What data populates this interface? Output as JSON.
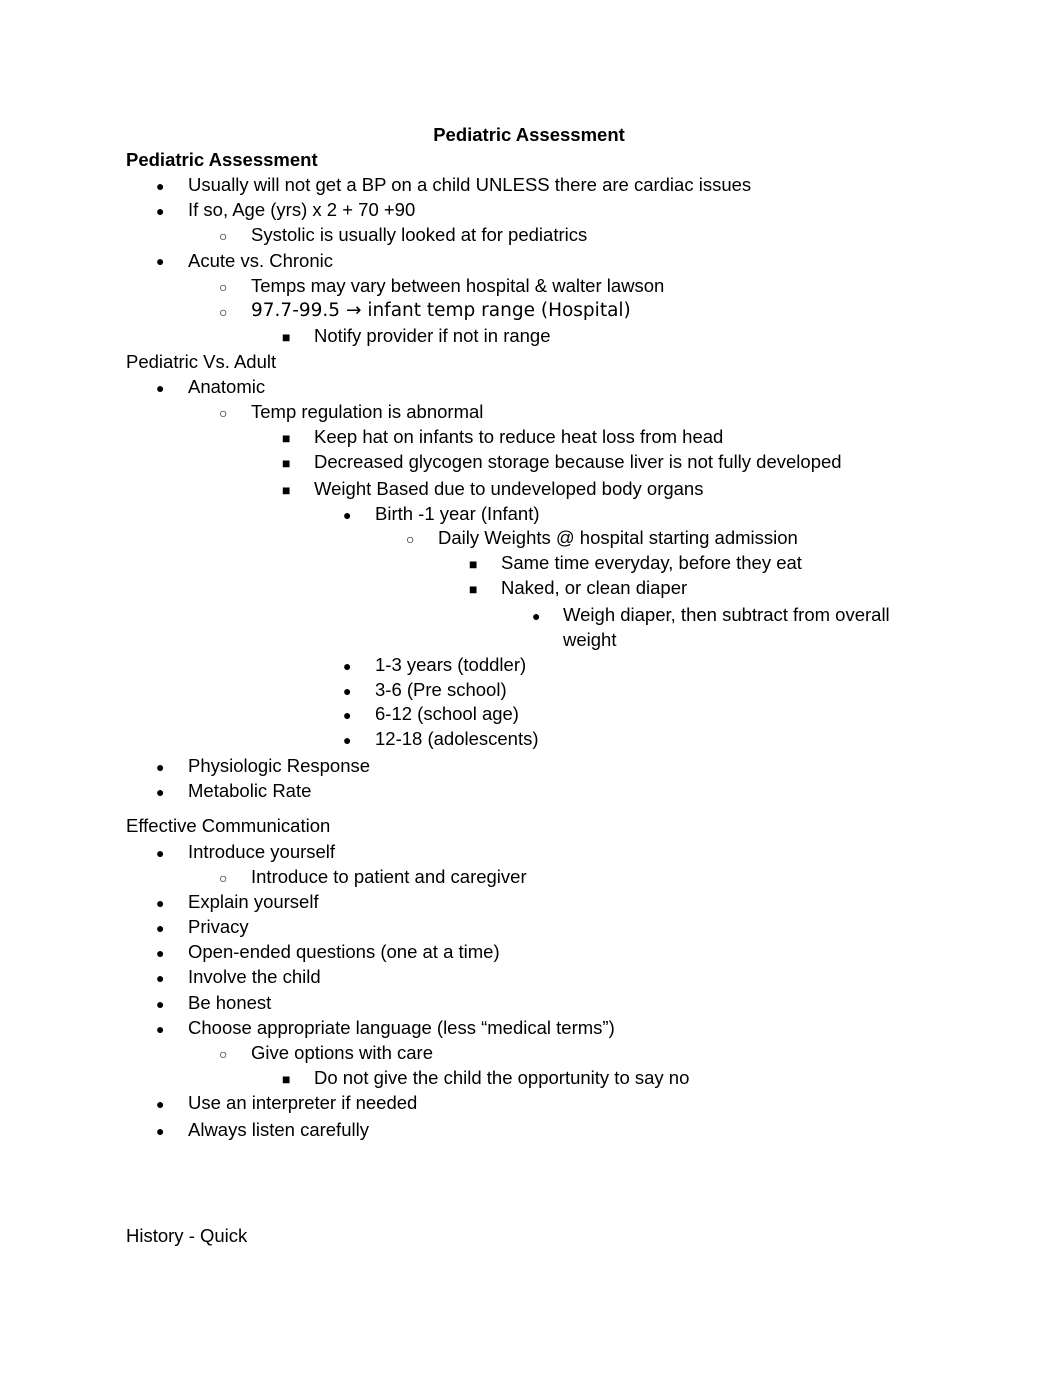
{
  "document": {
    "title": "Pediatric Assessment",
    "sections": [
      {
        "heading": "Pediatric Assessment",
        "items": [
          {
            "text": "Usually will not get a BP on a child UNLESS there are cardiac issues",
            "level": 1
          },
          {
            "text": "If so, Age (yrs) x 2 + 70 +90",
            "level": 1
          },
          {
            "text": "Systolic is usually looked at for pediatrics",
            "level": 2
          },
          {
            "text": "Acute vs. Chronic",
            "level": 1
          },
          {
            "text": "Temps may vary between hospital & walter lawson",
            "level": 2
          },
          {
            "text": "97.7-99.5 → infant temp range (Hospital)",
            "level": 2
          },
          {
            "text": "Notify provider if not in range",
            "level": 3
          }
        ]
      },
      {
        "heading": "Pediatric Vs. Adult",
        "items": [
          {
            "text": "Anatomic",
            "level": 1
          },
          {
            "text": "Temp regulation is abnormal",
            "level": 2
          },
          {
            "text": "Keep hat on infants to reduce heat loss from head",
            "level": 3
          },
          {
            "text": "Decreased glycogen storage because liver is not fully developed",
            "level": 3
          },
          {
            "text": "Weight Based due to undeveloped body organs",
            "level": 3
          },
          {
            "text": "Birth -1 year (Infant)",
            "level": 4
          },
          {
            "text": "Daily Weights @ hospital starting admission",
            "level": 5
          },
          {
            "text": "Same time everyday, before they eat",
            "level": 6
          },
          {
            "text": "Naked, or clean diaper",
            "level": 6
          },
          {
            "text": "Weigh diaper, then subtract from overall",
            "level": 7
          },
          {
            "text": "weight",
            "level": 7
          },
          {
            "text": "1-3 years (toddler)",
            "level": 4
          },
          {
            "text": "3-6 (Pre school)",
            "level": 4
          },
          {
            "text": "6-12 (school age)",
            "level": 4
          },
          {
            "text": "12-18 (adolescents)",
            "level": 4
          },
          {
            "text": "Physiologic Response",
            "level": 1
          },
          {
            "text": "Metabolic Rate",
            "level": 1
          }
        ]
      },
      {
        "heading": "Effective Communication",
        "items": [
          {
            "text": "Introduce yourself",
            "level": 1
          },
          {
            "text": "Introduce to patient and caregiver",
            "level": 2
          },
          {
            "text": "Explain yourself",
            "level": 1
          },
          {
            "text": "Privacy",
            "level": 1
          },
          {
            "text": "Open-ended questions (one at a time)",
            "level": 1
          },
          {
            "text": "Involve the child",
            "level": 1
          },
          {
            "text": "Be honest",
            "level": 1
          },
          {
            "text": "Choose appropriate language (less “medical  terms”)",
            "level": 1
          },
          {
            "text": "Give options with care",
            "level": 2
          },
          {
            "text": "Do not give the child the opportunity to say no",
            "level": 3
          },
          {
            "text": "Use an interpreter if needed",
            "level": 1
          },
          {
            "text": "Always listen carefully",
            "level": 1
          }
        ]
      },
      {
        "heading": "History - Quick",
        "items": []
      }
    ]
  }
}
